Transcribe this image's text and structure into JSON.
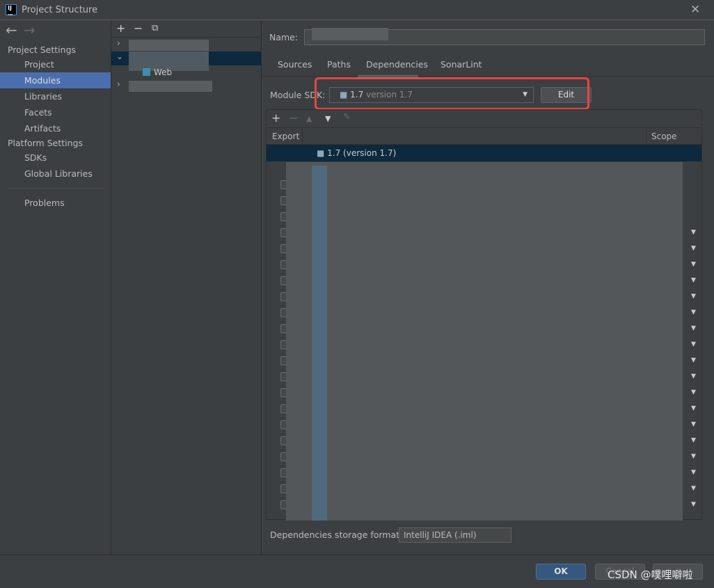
{
  "window": {
    "title": "Project Structure",
    "logo": "IJ"
  },
  "sidebar": {
    "back_icon": "←",
    "forward_icon": "→",
    "project_settings": "Project Settings",
    "platform_settings": "Platform Settings",
    "items": [
      {
        "label": "Project"
      },
      {
        "label": "Modules",
        "selected": true
      },
      {
        "label": "Libraries"
      },
      {
        "label": "Facets"
      },
      {
        "label": "Artifacts"
      }
    ],
    "platform_items": [
      {
        "label": "SDKs"
      },
      {
        "label": "Global Libraries"
      }
    ],
    "problems": "Problems"
  },
  "tree": {
    "add": "+",
    "remove": "−",
    "copy": "⧉",
    "child_label": "Web"
  },
  "main": {
    "name_label": "Name:",
    "tabs": [
      {
        "label": "Sources"
      },
      {
        "label": "Paths"
      },
      {
        "label": "Dependencies",
        "active": true
      },
      {
        "label": "SonarLint"
      }
    ],
    "sdk_label": "Module SDK:",
    "sdk_value": "1.7",
    "sdk_version": "version 1.7",
    "edit_label": "Edit",
    "columns": {
      "export": "Export",
      "scope": "Scope"
    },
    "sdk_row": "1.7 (version 1.7)",
    "storage_label": "Dependencies storage format:",
    "storage_value": "IntelliJ IDEA (.iml)"
  },
  "footer": {
    "ok": "OK",
    "cancel": "Cancel"
  },
  "watermark": "CSDN @噗哩噼啦",
  "colors": {
    "selection": "#4b6eaf",
    "highlight": "#e84545",
    "ok": "#365880"
  }
}
